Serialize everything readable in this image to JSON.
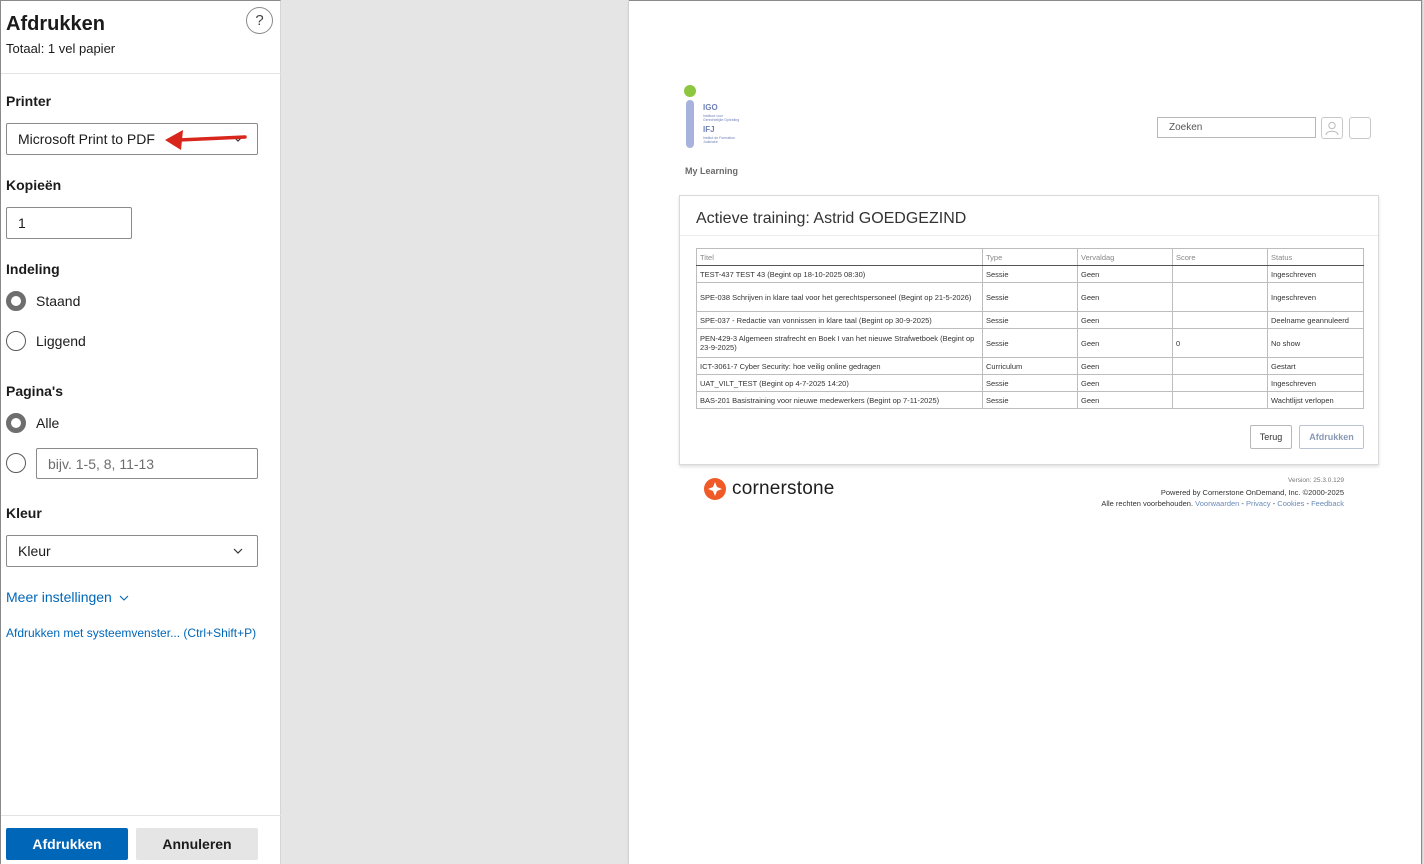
{
  "dialog": {
    "title": "Afdrukken",
    "subtitle": "Totaal: 1 vel papier",
    "help_label": "?",
    "printer": {
      "label": "Printer",
      "value": "Microsoft Print to PDF"
    },
    "copies": {
      "label": "Kopieën",
      "value": "1"
    },
    "layout": {
      "label": "Indeling",
      "options": [
        "Staand",
        "Liggend"
      ],
      "selected": "Staand"
    },
    "pages": {
      "label": "Pagina's",
      "all_label": "Alle",
      "range_placeholder": "bijv. 1-5, 8, 11-13"
    },
    "color": {
      "label": "Kleur",
      "value": "Kleur"
    },
    "more_settings": "Meer instellingen",
    "system_dialog": "Afdrukken met systeemvenster... (Ctrl+Shift+P)",
    "print_button": "Afdrukken",
    "cancel_button": "Annuleren",
    "arrow_color": "#d9261c",
    "accent": "#0067b8"
  },
  "preview": {
    "logo": {
      "line1": "IGO",
      "line2": "Instituut voor Gerechtelijke Opleiding",
      "line3": "IFJ",
      "line4": "Institut de Formation Judiciaire"
    },
    "search_placeholder": "Zoeken",
    "nav": "My Learning",
    "card_title": "Actieve training: Astrid GOEDGEZIND",
    "table": {
      "headers": [
        "Titel",
        "Type",
        "Vervaldag",
        "Score",
        "Status"
      ],
      "rows": [
        [
          "TEST-437 TEST 43 (Begint op 18-10-2025 08:30)",
          "Sessie",
          "Geen",
          "",
          "Ingeschreven"
        ],
        [
          "SPE-038 Schrijven in klare taal voor het gerechtspersoneel (Begint op 21-5-2026)",
          "Sessie",
          "Geen",
          "",
          "Ingeschreven"
        ],
        [
          "SPE-037 - Redactie van vonnissen in klare taal (Begint op 30-9-2025)",
          "Sessie",
          "Geen",
          "",
          "Deelname geannuleerd"
        ],
        [
          "PEN-429-3 Algemeen strafrecht en Boek I van het nieuwe Strafwetboek (Begint op 23-9-2025)",
          "Sessie",
          "Geen",
          "0",
          "No show"
        ],
        [
          "ICT-3061-7 Cyber Security: hoe veilig online gedragen",
          "Curriculum",
          "Geen",
          "",
          "Gestart"
        ],
        [
          "UAT_VILT_TEST (Begint op 4-7-2025 14:20)",
          "Sessie",
          "Geen",
          "",
          "Ingeschreven"
        ],
        [
          "BAS-201 Basistraining voor nieuwe medewerkers (Begint op 7-11-2025)",
          "Sessie",
          "Geen",
          "",
          "Wachtlijst verlopen"
        ]
      ]
    },
    "back_button": "Terug",
    "print_button": "Afdrukken",
    "brand": "cornerstone",
    "footer": {
      "version": "Version: 25.3.0.129",
      "powered": "Powered by Cornerstone OnDemand, Inc. ©2000-2025",
      "rights": "Alle rechten voorbehouden.",
      "links": [
        "Voorwaarden",
        "Privacy",
        "Cookies",
        "Feedback"
      ]
    }
  }
}
